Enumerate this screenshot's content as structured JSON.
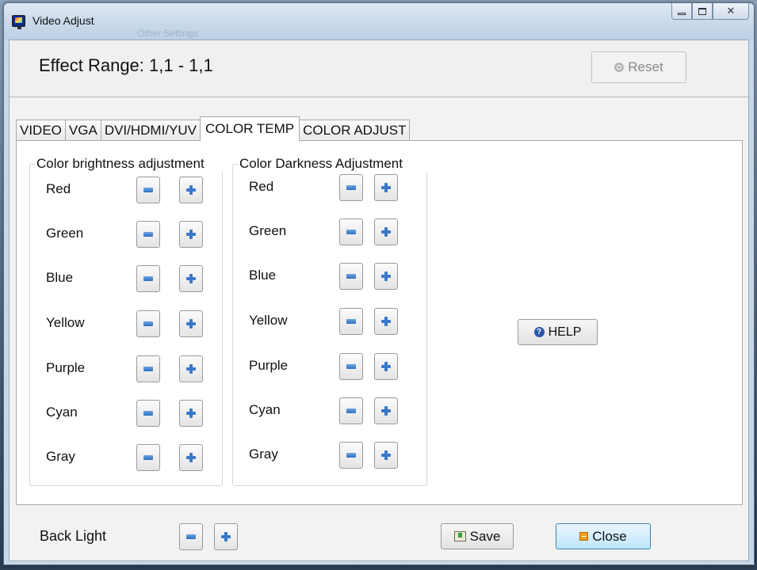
{
  "window": {
    "title": "Video Adjust",
    "ghost_text": "Other Settings",
    "controls": {
      "minimize": "",
      "maximize": "",
      "close": "✕"
    }
  },
  "header": {
    "effect_range": "Effect Range: 1,1 - 1,1",
    "reset_label": "Reset"
  },
  "tabs": [
    {
      "label": "VIDEO",
      "active": false
    },
    {
      "label": "VGA",
      "active": false
    },
    {
      "label": "DVI/HDMI/YUV",
      "active": false
    },
    {
      "label": "COLOR TEMP",
      "active": true
    },
    {
      "label": "COLOR ADJUST",
      "active": false
    }
  ],
  "brightness": {
    "title": "Color brightness adjustment",
    "rows": [
      "Red",
      "Green",
      "Blue",
      "Yellow",
      "Purple",
      "Cyan",
      "Gray"
    ]
  },
  "darkness": {
    "title": "Color Darkness Adjustment",
    "rows": [
      "Red",
      "Green",
      "Blue",
      "Yellow",
      "Purple",
      "Cyan",
      "Gray"
    ]
  },
  "help": {
    "label": "HELP",
    "icon": "?"
  },
  "footer": {
    "backlight_label": "Back Light",
    "save_label": "Save",
    "close_label": "Close"
  },
  "colors": {
    "titlebar": "#c9d9ea",
    "accent_blue": "#3a78c8",
    "close_button_bg": "#bee6fd"
  }
}
